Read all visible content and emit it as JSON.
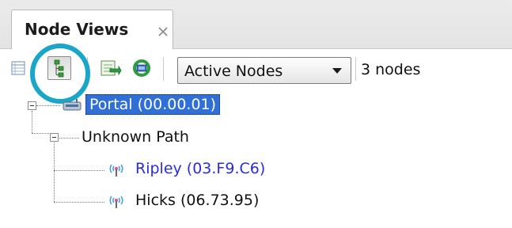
{
  "tab": {
    "title": "Node Views"
  },
  "toolbar": {
    "filter_dropdown": {
      "selected": "Active Nodes"
    },
    "node_count": "3 nodes"
  },
  "tree": {
    "portal": {
      "label": "Portal (00.00.01)"
    },
    "unknown_path": {
      "label": "Unknown Path"
    },
    "ripley": {
      "label": "Ripley (03.F9.C6)"
    },
    "hicks": {
      "label": "Hicks (06.73.95)"
    }
  },
  "colors": {
    "highlight_ring": "#1aa6c8",
    "selection": "#2f6fd6",
    "link_text": "#2a2ae0"
  }
}
